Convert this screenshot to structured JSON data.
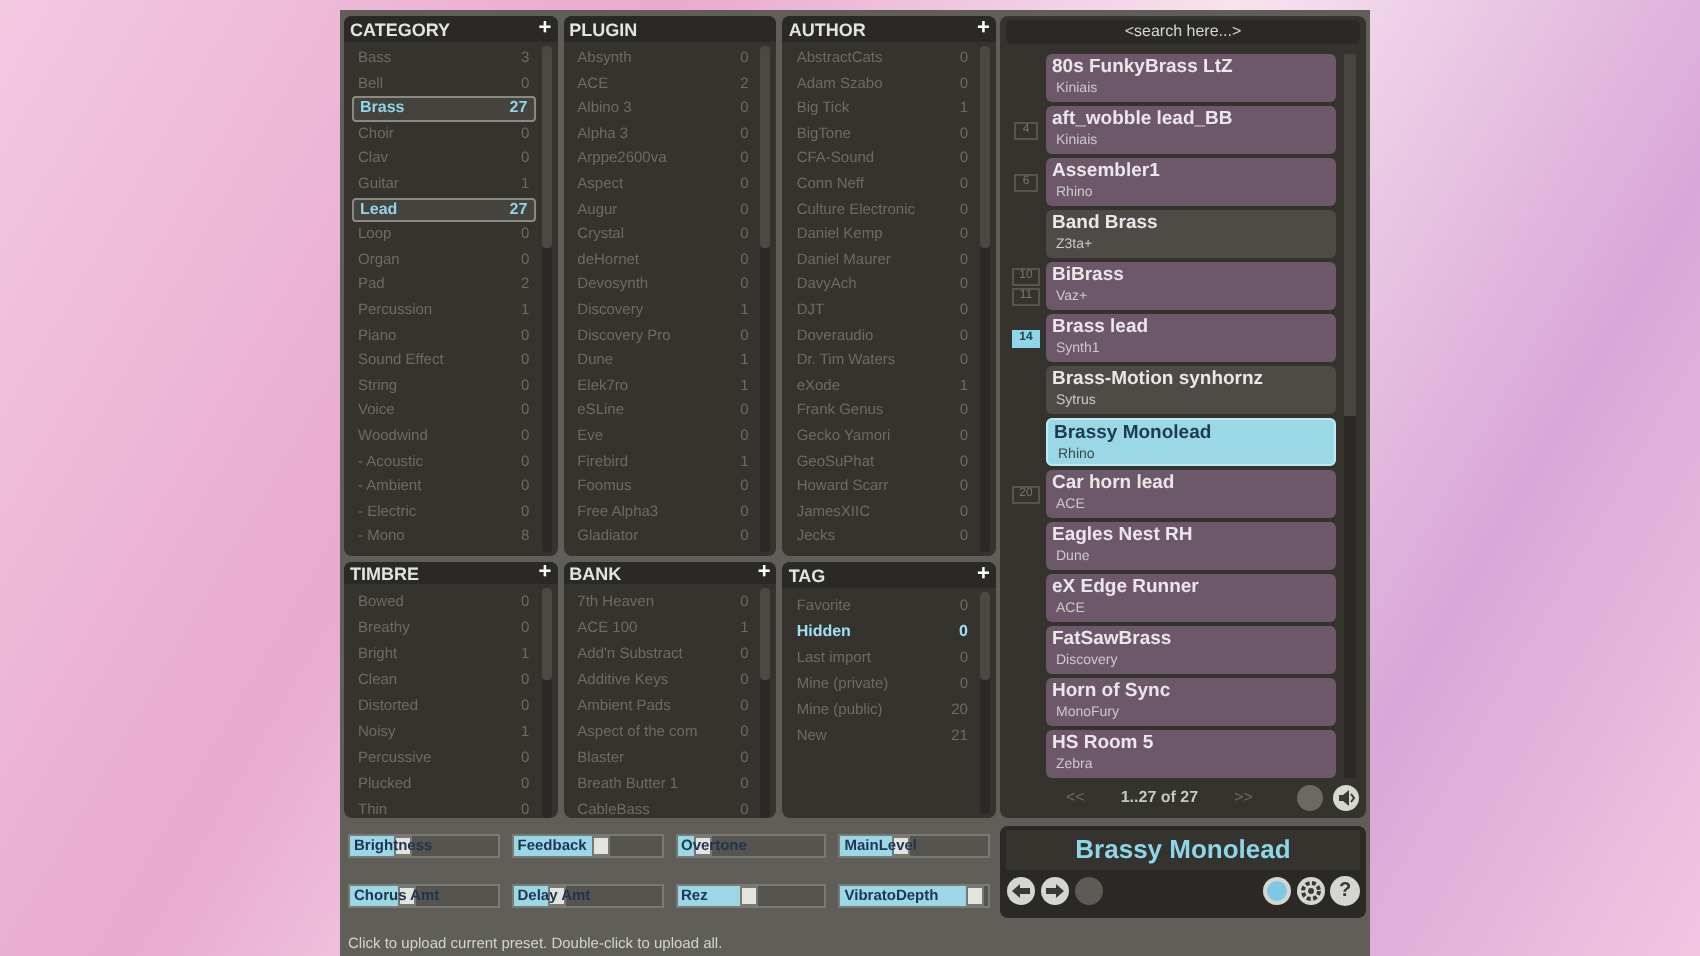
{
  "panels": [
    {
      "title": "CATEGORY",
      "kind": "boxed",
      "add_button": "+",
      "items": [
        {
          "label": "Bass",
          "count": "3",
          "selected": false
        },
        {
          "label": "Bell",
          "count": "0",
          "selected": false
        },
        {
          "label": "Brass",
          "count": "27",
          "selected": true
        },
        {
          "label": "Choir",
          "count": "0",
          "selected": false
        },
        {
          "label": "Clav",
          "count": "0",
          "selected": false
        },
        {
          "label": "Guitar",
          "count": "1",
          "selected": false
        },
        {
          "label": "Lead",
          "count": "27",
          "selected": true
        },
        {
          "label": "Loop",
          "count": "0",
          "selected": false
        },
        {
          "label": "Organ",
          "count": "0",
          "selected": false
        },
        {
          "label": "Pad",
          "count": "2",
          "selected": false
        },
        {
          "label": "Percussion",
          "count": "1",
          "selected": false
        },
        {
          "label": "Piano",
          "count": "0",
          "selected": false
        },
        {
          "label": "Sound Effect",
          "count": "0",
          "selected": false
        },
        {
          "label": "String",
          "count": "0",
          "selected": false
        },
        {
          "label": "Voice",
          "count": "0",
          "selected": false
        },
        {
          "label": "Woodwind",
          "count": "0",
          "selected": false
        },
        {
          "label": "- Acoustic",
          "count": "0",
          "selected": false
        },
        {
          "label": "- Ambient",
          "count": "0",
          "selected": false
        },
        {
          "label": "- Electric",
          "count": "0",
          "selected": false
        },
        {
          "label": "- Mono",
          "count": "8",
          "selected": false
        }
      ]
    },
    {
      "title": "PLUGIN",
      "kind": "boxed",
      "items": [
        {
          "label": "Absynth",
          "count": "0",
          "selected": false
        },
        {
          "label": "ACE",
          "count": "2",
          "selected": false
        },
        {
          "label": "Albino 3",
          "count": "0",
          "selected": false
        },
        {
          "label": "Alpha 3",
          "count": "0",
          "selected": false
        },
        {
          "label": "Arppe2600va",
          "count": "0",
          "selected": false
        },
        {
          "label": "Aspect",
          "count": "0",
          "selected": false
        },
        {
          "label": "Augur",
          "count": "0",
          "selected": false
        },
        {
          "label": "Crystal",
          "count": "0",
          "selected": false
        },
        {
          "label": "deHornet",
          "count": "0",
          "selected": false
        },
        {
          "label": "Devosynth",
          "count": "0",
          "selected": false
        },
        {
          "label": "Discovery",
          "count": "1",
          "selected": false
        },
        {
          "label": "Discovery Pro",
          "count": "0",
          "selected": false
        },
        {
          "label": "Dune",
          "count": "1",
          "selected": false
        },
        {
          "label": "Elek7ro",
          "count": "1",
          "selected": false
        },
        {
          "label": "eSLine",
          "count": "0",
          "selected": false
        },
        {
          "label": "Eve",
          "count": "0",
          "selected": false
        },
        {
          "label": "Firebird",
          "count": "1",
          "selected": false
        },
        {
          "label": "Foomus",
          "count": "0",
          "selected": false
        },
        {
          "label": "Free Alpha3",
          "count": "0",
          "selected": false
        },
        {
          "label": "Gladiator",
          "count": "0",
          "selected": false
        }
      ]
    },
    {
      "title": "AUTHOR",
      "kind": "boxed",
      "add_button": "+",
      "items": [
        {
          "label": "AbstractCats",
          "count": "0",
          "selected": false
        },
        {
          "label": "Adam Szabo",
          "count": "0",
          "selected": false
        },
        {
          "label": "Big Tick",
          "count": "1",
          "selected": false
        },
        {
          "label": "BigTone",
          "count": "0",
          "selected": false
        },
        {
          "label": "CFA-Sound",
          "count": "0",
          "selected": false
        },
        {
          "label": "Conn Neff",
          "count": "0",
          "selected": false
        },
        {
          "label": "Culture Electronic",
          "count": "0",
          "selected": false
        },
        {
          "label": "Daniel Kemp",
          "count": "0",
          "selected": false
        },
        {
          "label": "Daniel Maurer",
          "count": "0",
          "selected": false
        },
        {
          "label": "DavyAch",
          "count": "0",
          "selected": false
        },
        {
          "label": "DJT",
          "count": "0",
          "selected": false
        },
        {
          "label": "Doveraudio",
          "count": "0",
          "selected": false
        },
        {
          "label": "Dr. Tim Waters",
          "count": "0",
          "selected": false
        },
        {
          "label": "eXode",
          "count": "1",
          "selected": false
        },
        {
          "label": "Frank Genus",
          "count": "0",
          "selected": false
        },
        {
          "label": "Gecko Yamori",
          "count": "0",
          "selected": false
        },
        {
          "label": "GeoSuPhat",
          "count": "0",
          "selected": false
        },
        {
          "label": "Howard Scarr",
          "count": "0",
          "selected": false
        },
        {
          "label": "JamesXIIC",
          "count": "0",
          "selected": false
        },
        {
          "label": "Jecks",
          "count": "0",
          "selected": false
        }
      ]
    },
    {
      "title": "TIMBRE",
      "kind": "boxed",
      "add_button": "+",
      "items": [
        {
          "label": "Bowed",
          "count": "0",
          "selected": false
        },
        {
          "label": "Breathy",
          "count": "0",
          "selected": false
        },
        {
          "label": "Bright",
          "count": "1",
          "selected": false
        },
        {
          "label": "Clean",
          "count": "0",
          "selected": false
        },
        {
          "label": "Distorted",
          "count": "0",
          "selected": false
        },
        {
          "label": "Noisy",
          "count": "1",
          "selected": false
        },
        {
          "label": "Percussive",
          "count": "0",
          "selected": false
        },
        {
          "label": "Plucked",
          "count": "0",
          "selected": false
        },
        {
          "label": "Thin",
          "count": "0",
          "selected": false
        }
      ]
    },
    {
      "title": "BANK",
      "kind": "boxed",
      "add_button": "+",
      "items": [
        {
          "label": "7th Heaven",
          "count": "0",
          "selected": false
        },
        {
          "label": "ACE 100",
          "count": "1",
          "selected": false
        },
        {
          "label": "Add'n Substract",
          "count": "0",
          "selected": false
        },
        {
          "label": "Additive Keys",
          "count": "0",
          "selected": false
        },
        {
          "label": "Ambient Pads",
          "count": "0",
          "selected": false
        },
        {
          "label": "Aspect of the com",
          "count": "0",
          "selected": false
        },
        {
          "label": "Blaster",
          "count": "0",
          "selected": false
        },
        {
          "label": "Breath Butter 1",
          "count": "0",
          "selected": false
        },
        {
          "label": "CableBass",
          "count": "0",
          "selected": false
        }
      ]
    },
    {
      "title": "TAG",
      "kind": "plain",
      "add_button": "+",
      "items": [
        {
          "label": "Favorite",
          "count": "0",
          "selected": false
        },
        {
          "label": "Hidden",
          "count": "0",
          "selected": true
        },
        {
          "label": "Last import",
          "count": "0",
          "selected": false
        },
        {
          "label": "Mine (private)",
          "count": "0",
          "selected": false
        },
        {
          "label": "Mine (public)",
          "count": "20",
          "selected": false
        },
        {
          "label": "New",
          "count": "21",
          "selected": false
        }
      ]
    }
  ],
  "search": {
    "placeholder": "<search here...>"
  },
  "presets": [
    {
      "name": "80s FunkyBrass LtZ",
      "author": "Kiniais",
      "color": "#6d5869",
      "selected": false
    },
    {
      "name": "aft_wobble lead_BB",
      "author": "Kiniais",
      "color": "#6d5869",
      "selected": false,
      "markers": [
        {
          "text": "4",
          "selected": false
        }
      ]
    },
    {
      "name": "Assembler1",
      "author": "Rhino",
      "color": "#6d5869",
      "selected": false,
      "markers": [
        {
          "text": "6",
          "selected": false
        }
      ]
    },
    {
      "name": "Band Brass",
      "author": "Z3ta+",
      "color": "#4d4b45",
      "selected": false
    },
    {
      "name": "BiBrass",
      "author": "Vaz+",
      "color": "#6d5869",
      "selected": false,
      "markers": [
        {
          "text": "10",
          "selected": false
        },
        {
          "text": "11",
          "selected": false
        }
      ]
    },
    {
      "name": "Brass lead",
      "author": "Synth1",
      "color": "#6d5869",
      "selected": false,
      "markers": [
        {
          "text": "14",
          "selected": true
        }
      ]
    },
    {
      "name": "Brass-Motion synhornz",
      "author": "Sytrus",
      "color": "#4d4b45",
      "selected": false
    },
    {
      "name": "Brassy Monolead",
      "author": "Rhino",
      "selected": true
    },
    {
      "name": "Car horn lead",
      "author": "ACE",
      "color": "#6d5869",
      "selected": false,
      "markers": [
        {
          "text": "20",
          "selected": false
        }
      ]
    },
    {
      "name": "Eagles Nest RH",
      "author": "Dune",
      "color": "#6d5869",
      "selected": false
    },
    {
      "name": "eX Edge Runner",
      "author": "ACE",
      "color": "#6d5869",
      "selected": false
    },
    {
      "name": "FatSawBrass",
      "author": "Discovery",
      "color": "#6d5869",
      "selected": false
    },
    {
      "name": "Horn of Sync",
      "author": "MonoFury",
      "color": "#6d5869",
      "selected": false
    },
    {
      "name": "HS Room 5",
      "author": "Zebra",
      "color": "#6d5869",
      "selected": false
    }
  ],
  "pager": {
    "prev": "<<",
    "range": "1..27 of 27",
    "next": ">>",
    "disabled": true
  },
  "sliders": [
    {
      "label": "Brightness",
      "level": 0.42
    },
    {
      "label": "Feedback",
      "level": 0.66
    },
    {
      "label": "Overtone",
      "level": 0.24
    },
    {
      "label": "MainLevel",
      "level": 0.47
    },
    {
      "label": "Chorus Amt",
      "level": 0.45
    },
    {
      "label": "Delay Amt",
      "level": 0.35
    },
    {
      "label": "Rez",
      "level": 0.55
    },
    {
      "label": "VibratoDepth",
      "level": 0.97
    }
  ],
  "display": {
    "preset_name": "Brassy Monolead",
    "help": "?"
  },
  "status_bar": "Click to upload current preset. Double-click to upload all."
}
